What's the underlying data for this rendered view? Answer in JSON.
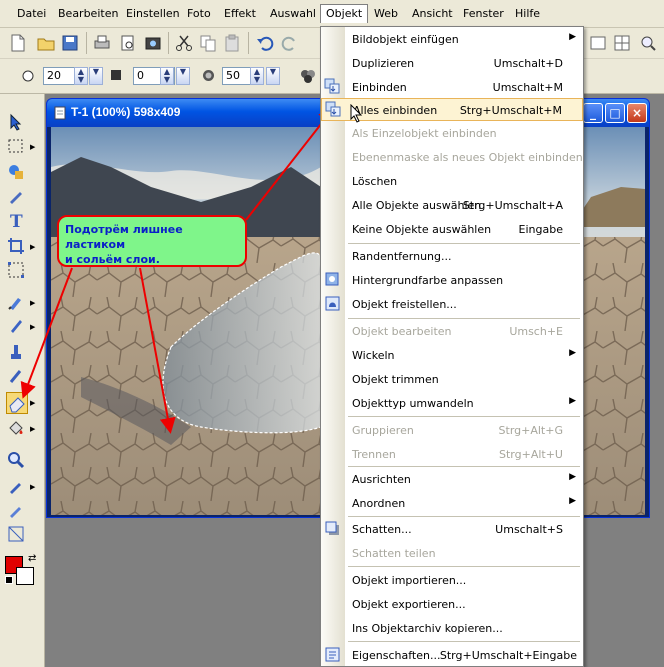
{
  "menubar": {
    "items": [
      "Datei",
      "Bearbeiten",
      "Einstellen",
      "Foto",
      "Effekt",
      "Auswahl",
      "Objekt",
      "Web",
      "Ansicht",
      "Fenster",
      "Hilfe"
    ],
    "active": "Objekt"
  },
  "toolbar2": {
    "field1": "20",
    "field2": "0",
    "field3": "50"
  },
  "document": {
    "title": "T-1 (100%) 598x409"
  },
  "annotation": {
    "line1": "Подотрём лишнее ластиком",
    "line2": "и сольём слои."
  },
  "menu": {
    "items": [
      {
        "label": "Bildobjekt einfügen",
        "shortcut": "",
        "submenu": true,
        "disabled": false,
        "icon": ""
      },
      {
        "label": "Duplizieren",
        "shortcut": "Umschalt+D",
        "submenu": false,
        "disabled": false,
        "icon": ""
      },
      {
        "label": "Einbinden",
        "shortcut": "Umschalt+M",
        "submenu": false,
        "disabled": false,
        "icon": "merge-icon"
      },
      {
        "label": "Alles einbinden",
        "shortcut": "Strg+Umschalt+M",
        "submenu": false,
        "disabled": false,
        "icon": "merge-all-icon",
        "highlighted": true
      },
      {
        "label": "Als Einzelobjekt einbinden",
        "shortcut": "",
        "submenu": false,
        "disabled": true,
        "icon": ""
      },
      {
        "label": "Ebenenmaske als neues Objekt einbinden",
        "shortcut": "",
        "submenu": false,
        "disabled": true,
        "icon": ""
      },
      {
        "label": "Löschen",
        "shortcut": "",
        "submenu": false,
        "disabled": false,
        "icon": ""
      },
      {
        "label": "Alle Objekte auswählen",
        "shortcut": "Strg+Umschalt+A",
        "submenu": false,
        "disabled": false,
        "icon": ""
      },
      {
        "label": "Keine Objekte auswählen",
        "shortcut": "Eingabe",
        "submenu": false,
        "disabled": false,
        "icon": ""
      },
      {
        "label": "Randentfernung...",
        "shortcut": "",
        "submenu": false,
        "disabled": false,
        "icon": ""
      },
      {
        "label": "Hintergrundfarbe anpassen",
        "shortcut": "",
        "submenu": false,
        "disabled": false,
        "icon": "bg-color-icon"
      },
      {
        "label": "Objekt freistellen...",
        "shortcut": "",
        "submenu": false,
        "disabled": false,
        "icon": "cutout-icon"
      },
      {
        "label": "Objekt bearbeiten",
        "shortcut": "Umsch+E",
        "submenu": false,
        "disabled": true,
        "icon": ""
      },
      {
        "label": "Wickeln",
        "shortcut": "",
        "submenu": true,
        "disabled": false,
        "icon": ""
      },
      {
        "label": "Objekt trimmen",
        "shortcut": "",
        "submenu": false,
        "disabled": false,
        "icon": ""
      },
      {
        "label": "Objekttyp umwandeln",
        "shortcut": "",
        "submenu": true,
        "disabled": false,
        "icon": ""
      },
      {
        "label": "Gruppieren",
        "shortcut": "Strg+Alt+G",
        "submenu": false,
        "disabled": true,
        "icon": ""
      },
      {
        "label": "Trennen",
        "shortcut": "Strg+Alt+U",
        "submenu": false,
        "disabled": true,
        "icon": ""
      },
      {
        "label": "Ausrichten",
        "shortcut": "",
        "submenu": true,
        "disabled": false,
        "icon": ""
      },
      {
        "label": "Anordnen",
        "shortcut": "",
        "submenu": true,
        "disabled": false,
        "icon": ""
      },
      {
        "label": "Schatten...",
        "shortcut": "Umschalt+S",
        "submenu": false,
        "disabled": false,
        "icon": "shadow-icon"
      },
      {
        "label": "Schatten teilen",
        "shortcut": "",
        "submenu": false,
        "disabled": true,
        "icon": ""
      },
      {
        "label": "Objekt importieren...",
        "shortcut": "",
        "submenu": false,
        "disabled": false,
        "icon": ""
      },
      {
        "label": "Objekt exportieren...",
        "shortcut": "",
        "submenu": false,
        "disabled": false,
        "icon": ""
      },
      {
        "label": "Ins Objektarchiv kopieren...",
        "shortcut": "",
        "submenu": false,
        "disabled": false,
        "icon": ""
      },
      {
        "label": "Eigenschaften...",
        "shortcut": "Strg+Umschalt+Eingabe",
        "submenu": false,
        "disabled": false,
        "icon": "properties-icon"
      }
    ]
  },
  "colors": {
    "foreground": "#e00000",
    "background": "#ffffff",
    "annotation_fill": "#7ff58a",
    "annotation_border": "#e00000",
    "annotation_text": "#0a1fc9"
  }
}
